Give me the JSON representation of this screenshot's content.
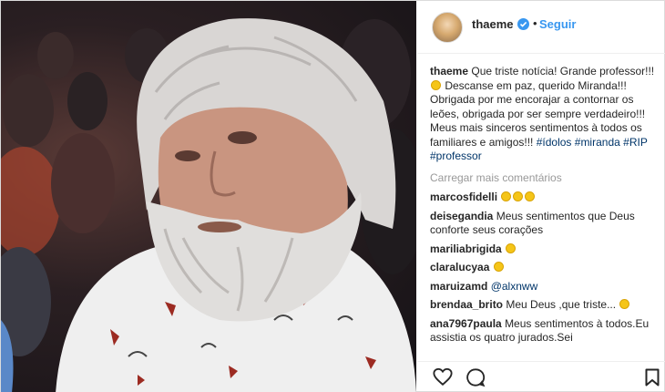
{
  "header": {
    "username": "thaeme",
    "dot": "•",
    "follow_label": "Seguir"
  },
  "caption": {
    "username": "thaeme",
    "text_1": "Que triste notícia! Grande professor!!!",
    "text_2": "Descanse em paz, querido Miranda!!! Obrigada por me encorajar a contornar os leões, obrigada por ser sempre verdadeiro!!! Meus mais sinceros sentimentos à todos os familiares e amigos!!!",
    "hashtags": [
      "#ídolos",
      "#miranda",
      "#RIP",
      "#professor"
    ]
  },
  "load_more_label": "Carregar mais comentários",
  "comments": [
    {
      "user": "marcosfidelli",
      "text": "",
      "emojis": 3
    },
    {
      "user": "deisegandia",
      "text": "Meus sentimentos que Deus conforte seus corações",
      "emojis": 0
    },
    {
      "user": "mariliabrigida",
      "text": "",
      "emojis": 1
    },
    {
      "user": "claralucyaa",
      "text": "",
      "emojis": 1
    },
    {
      "user": "maruizamd",
      "text": "@alxnww",
      "emojis": 0
    },
    {
      "user": "brendaa_brito",
      "text": "Meu Deus ,que triste...",
      "emojis": 1
    },
    {
      "user": "ana7967paula",
      "text": "Meus sentimentos à todos.Eu assistia os quatro jurados.Sei",
      "emojis": 0
    }
  ],
  "colors": {
    "link": "#3897f0",
    "hashtag": "#003569",
    "muted": "#999999"
  }
}
